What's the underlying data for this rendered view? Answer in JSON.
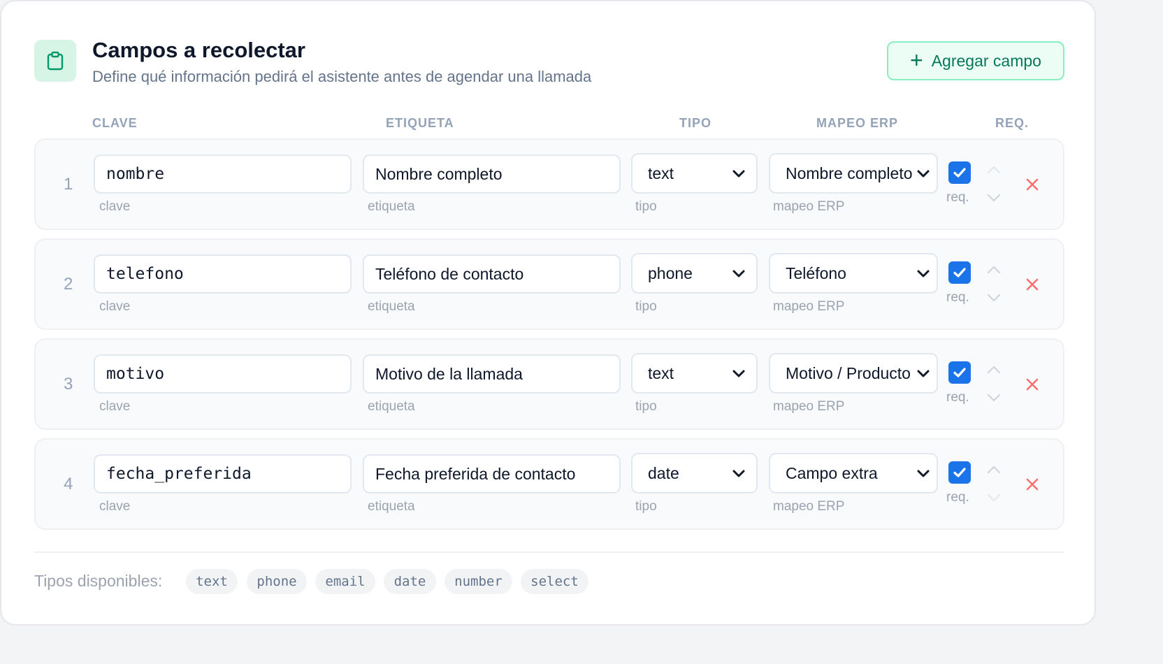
{
  "header": {
    "icon": "clipboard-icon",
    "title": "Campos a recolectar",
    "subtitle": "Define qué información pedirá el asistente antes de agendar una llamada",
    "add_button": {
      "icon": "plus-icon",
      "label": "Agregar campo"
    }
  },
  "columns": {
    "key": "CLAVE",
    "label": "ETIQUETA",
    "type": "TIPO",
    "erp": "MAPEO ERP",
    "req": "REQ."
  },
  "hints": {
    "key": "clave",
    "label": "etiqueta",
    "type": "tipo",
    "erp": "mapeo ERP",
    "req": "req."
  },
  "rows": [
    {
      "num": "1",
      "key": "nombre",
      "label": "Nombre completo",
      "type": "text",
      "erp": "Nombre completo",
      "required": true
    },
    {
      "num": "2",
      "key": "telefono",
      "label": "Teléfono de contacto",
      "type": "phone",
      "erp": "Teléfono",
      "required": true
    },
    {
      "num": "3",
      "key": "motivo",
      "label": "Motivo de la llamada",
      "type": "text",
      "erp": "Motivo / Producto",
      "required": true
    },
    {
      "num": "4",
      "key": "fecha_preferida",
      "label": "Fecha preferida de contacto",
      "type": "date",
      "erp": "Campo extra",
      "required": true
    }
  ],
  "footer": {
    "label": "Tipos disponibles:",
    "types": [
      "text",
      "phone",
      "email",
      "date",
      "number",
      "select"
    ]
  },
  "colors": {
    "accent": "#047857",
    "checkbox": "#1a73e8",
    "delete": "#f87171"
  }
}
